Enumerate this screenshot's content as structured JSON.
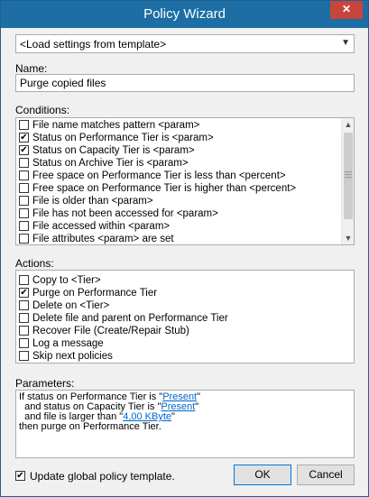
{
  "window": {
    "title": "Policy Wizard",
    "close_glyph": "✕"
  },
  "template_select": {
    "value": "<Load settings from template>",
    "arrow_icon": "chevron-down-icon"
  },
  "name": {
    "label": "Name:",
    "value": "Purge copied files"
  },
  "conditions": {
    "label": "Conditions:",
    "items": [
      {
        "label": "File name matches pattern <param>",
        "checked": false
      },
      {
        "label": "Status on Performance Tier is <param>",
        "checked": true
      },
      {
        "label": "Status on Capacity Tier is <param>",
        "checked": true
      },
      {
        "label": "Status on Archive Tier is <param>",
        "checked": false
      },
      {
        "label": "Free space on Performance Tier is less than <percent>",
        "checked": false
      },
      {
        "label": "Free space on Performance Tier is higher than <percent>",
        "checked": false
      },
      {
        "label": "File is older than <param>",
        "checked": false
      },
      {
        "label": "File has not been accessed for <param>",
        "checked": false
      },
      {
        "label": "File accessed within <param>",
        "checked": false
      },
      {
        "label": "File attributes <param> are set",
        "checked": false
      }
    ]
  },
  "actions": {
    "label": "Actions:",
    "items": [
      {
        "label": "Copy to <Tier>",
        "checked": false
      },
      {
        "label": "Purge on Performance Tier",
        "checked": true
      },
      {
        "label": "Delete on <Tier>",
        "checked": false
      },
      {
        "label": "Delete file and parent on Performance Tier",
        "checked": false
      },
      {
        "label": "Recover File (Create/Repair Stub)",
        "checked": false
      },
      {
        "label": "Log a message",
        "checked": false
      },
      {
        "label": "Skip next policies",
        "checked": false
      }
    ]
  },
  "parameters": {
    "label": "Parameters:",
    "line1_prefix": "If status on Performance Tier is \"",
    "line1_link": "Present",
    "line1_suffix": "\"",
    "line2_prefix": "  and status on Capacity Tier is \"",
    "line2_link": "Present",
    "line2_suffix": "\"",
    "line3_prefix": "  and file is larger than \"",
    "line3_link": "4,00 KByte",
    "line3_suffix": "\"",
    "line4": "then purge on Performance Tier."
  },
  "footer": {
    "update_label": "Update global policy template.",
    "update_checked": true,
    "ok_label": "OK",
    "cancel_label": "Cancel"
  },
  "colors": {
    "titlebar": "#1c6ea4",
    "close": "#c7453a",
    "link": "#0066cc"
  }
}
